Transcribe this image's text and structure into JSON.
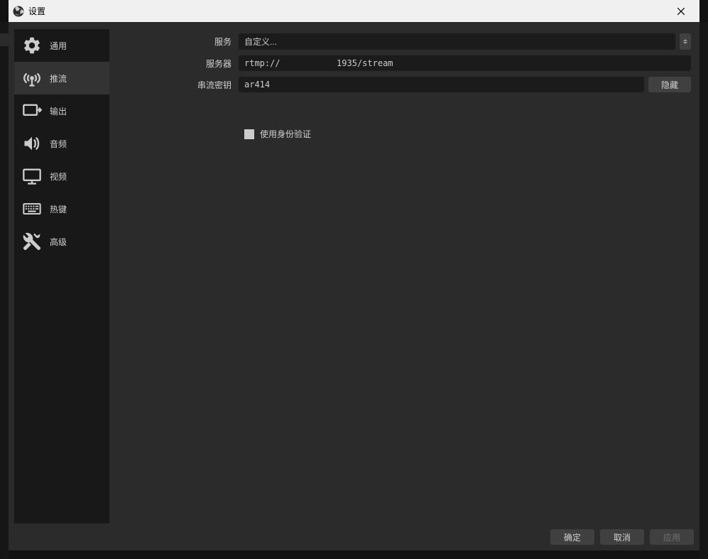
{
  "window": {
    "title": "设置"
  },
  "sidebar": {
    "items": [
      {
        "id": "general",
        "label": "通用"
      },
      {
        "id": "stream",
        "label": "推流"
      },
      {
        "id": "output",
        "label": "输出"
      },
      {
        "id": "audio",
        "label": "音频"
      },
      {
        "id": "video",
        "label": "视频"
      },
      {
        "id": "hotkeys",
        "label": "热键"
      },
      {
        "id": "advanced",
        "label": "高级"
      }
    ],
    "selected": "stream"
  },
  "form": {
    "service_label": "服务",
    "service_value": "自定义...",
    "server_label": "服务器",
    "server_value": "rtmp://           1935/stream",
    "streamkey_label": "串流密钥",
    "streamkey_value": "ar414",
    "hide_button": "隐藏",
    "use_auth_label": "使用身份验证",
    "use_auth_checked": false
  },
  "buttons": {
    "ok": "确定",
    "cancel": "取消",
    "apply": "应用"
  },
  "icons": {
    "close": "✕"
  }
}
